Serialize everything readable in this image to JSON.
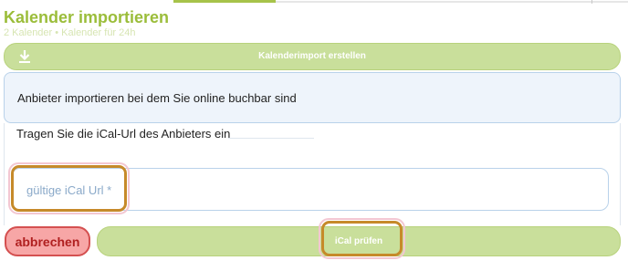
{
  "page": {
    "title": "Kalender importieren",
    "subtitle": "2 Kalender • Kalender für 24h"
  },
  "toolbar": {
    "create_import_label": "Kalenderimport erstellen",
    "create_import_icon": "download-icon"
  },
  "info": {
    "text": "Anbieter importieren bei dem Sie online buchbar sind"
  },
  "form": {
    "hint": "Tragen Sie die iCal-Url des Anbieters ein",
    "url_placeholder": "gültige iCal Url *",
    "url_value": ""
  },
  "actions": {
    "cancel_label": "abbrechen",
    "check_label": "iCal prüfen"
  },
  "colors": {
    "accent_green": "#9bbd3a",
    "button_green": "#c9df9b",
    "info_bg": "#eef4fb",
    "cancel_bg": "#f7a6a6",
    "cancel_text": "#b02020",
    "highlight": "#c68a2a"
  }
}
